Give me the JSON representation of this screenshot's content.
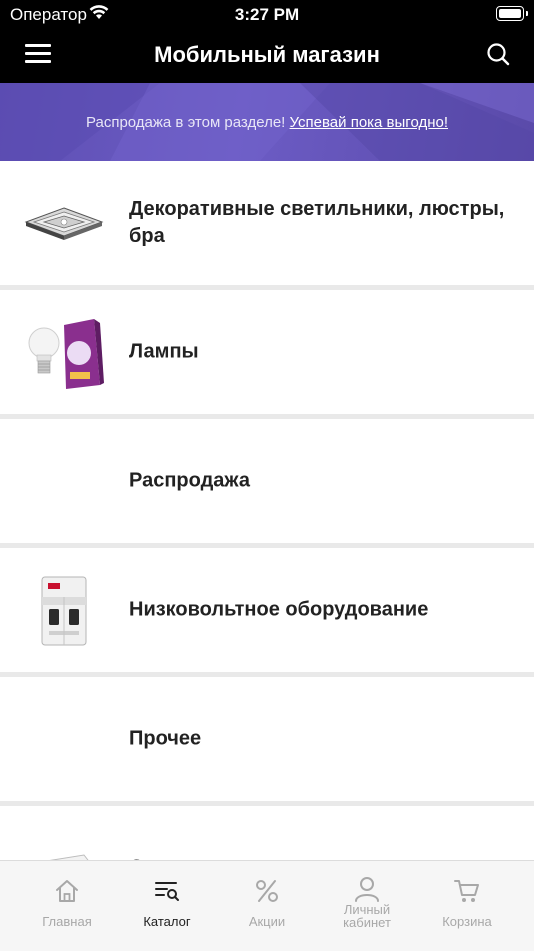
{
  "status_bar": {
    "carrier": "Оператор",
    "time": "3:27 PM"
  },
  "nav": {
    "title": "Мобильный магазин",
    "menu_icon": "hamburger-icon",
    "search_icon": "search-icon"
  },
  "promo": {
    "text": "Распродажа в этом разделе!",
    "link": "Успевай пока выгодно!"
  },
  "categories": [
    {
      "label": "Декоративные светильники, люстры, бра",
      "image": "chandelier"
    },
    {
      "label": "Лампы",
      "image": "led-bulb-box"
    },
    {
      "label": "Распродажа",
      "image": ""
    },
    {
      "label": "Низковольтное оборудование",
      "image": "circuit-breaker"
    },
    {
      "label": "Прочее",
      "image": ""
    },
    {
      "label": "Светильники накладные, панели",
      "image": "ceiling-panel"
    }
  ],
  "tabbar": {
    "items": [
      {
        "label": "Главная",
        "icon": "home-icon",
        "active": false
      },
      {
        "label": "Каталог",
        "icon": "catalog-icon",
        "active": true
      },
      {
        "label": "Акции",
        "icon": "percent-icon",
        "active": false
      },
      {
        "label": "Личный кабинет",
        "icon": "user-icon",
        "active": false
      },
      {
        "label": "Корзина",
        "icon": "cart-icon",
        "active": false
      }
    ]
  },
  "colors": {
    "promo_bg": "#6455bd",
    "nav_bg": "#000000",
    "tab_active": "#222222",
    "tab_inactive": "#a8a8a8"
  }
}
